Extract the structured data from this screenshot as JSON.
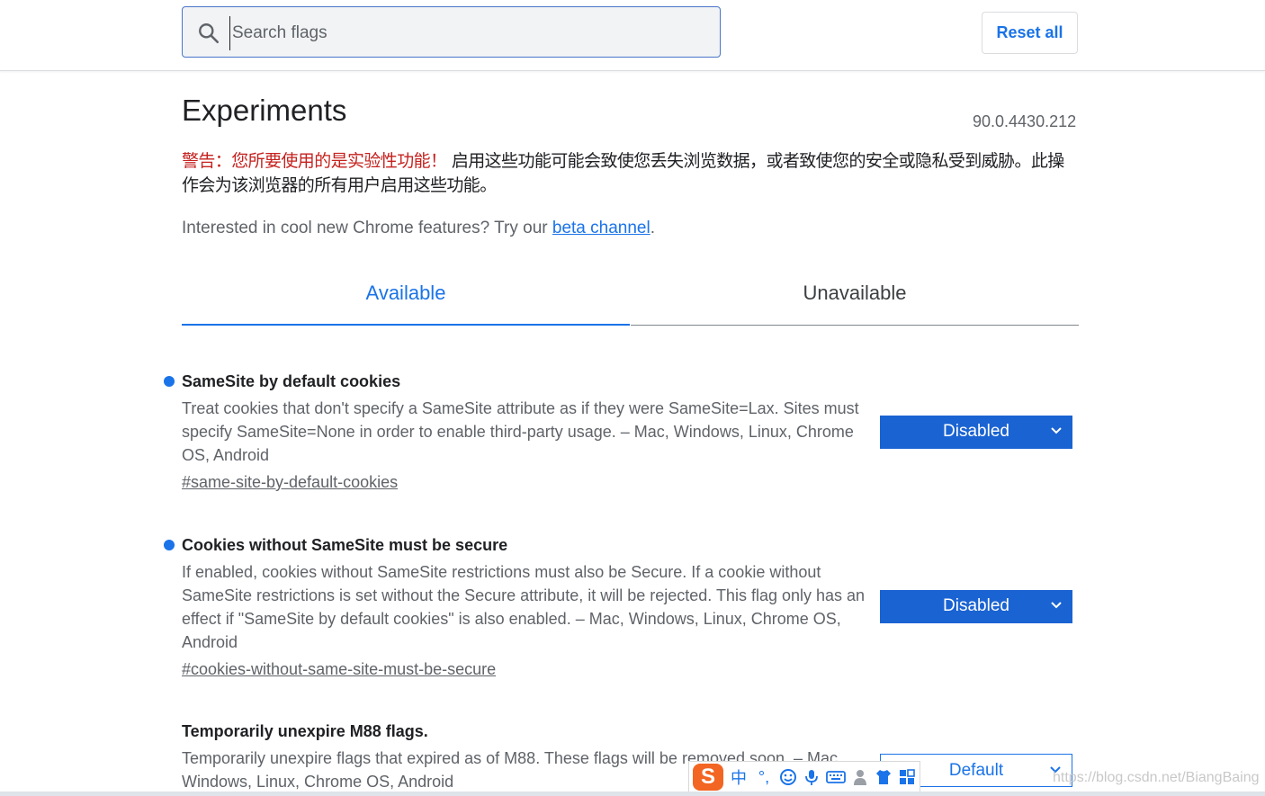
{
  "header": {
    "search_placeholder": "Search flags",
    "reset_label": "Reset all"
  },
  "page": {
    "title": "Experiments",
    "version": "90.0.4430.212",
    "warning_label": "警告：您所要使用的是实验性功能！",
    "warning_text": " 启用这些功能可能会致使您丢失浏览数据，或者致使您的安全或隐私受到威胁。此操作会为该浏览器的所有用户启用这些功能。",
    "promo_text": "Interested in cool new Chrome features? Try our ",
    "promo_link": "beta channel",
    "promo_end": "."
  },
  "tabs": [
    {
      "label": "Available",
      "active": true
    },
    {
      "label": "Unavailable",
      "active": false
    }
  ],
  "flags": [
    {
      "title": "SameSite by default cookies",
      "description": "Treat cookies that don't specify a SameSite attribute as if they were SameSite=Lax. Sites must specify SameSite=None in order to enable third-party usage. – Mac, Windows, Linux, Chrome OS, Android",
      "link": "#same-site-by-default-cookies",
      "value": "Disabled",
      "modified": true
    },
    {
      "title": "Cookies without SameSite must be secure",
      "description": "If enabled, cookies without SameSite restrictions must also be Secure. If a cookie without SameSite restrictions is set without the Secure attribute, it will be rejected. This flag only has an effect if \"SameSite by default cookies\" is also enabled. – Mac, Windows, Linux, Chrome OS, Android",
      "link": "#cookies-without-same-site-must-be-secure",
      "value": "Disabled",
      "modified": true
    },
    {
      "title": "Temporarily unexpire M88 flags.",
      "description": "Temporarily unexpire flags that expired as of M88. These flags will be removed soon. – Mac, Windows, Linux, Chrome OS, Android",
      "value": "Default",
      "modified": false
    }
  ],
  "ime_toolbar": {
    "logo": "S",
    "mode": "中",
    "punct": "°,",
    "items": [
      "smiley-icon",
      "microphone-icon",
      "keyboard-icon",
      "user-icon",
      "shirt-icon",
      "grid-icon"
    ]
  },
  "watermark": "https://blog.csdn.net/BiangBaing",
  "colors": {
    "accent": "#1a73e8",
    "select_bg": "#1a63d2",
    "warning_red": "#c5221f"
  }
}
